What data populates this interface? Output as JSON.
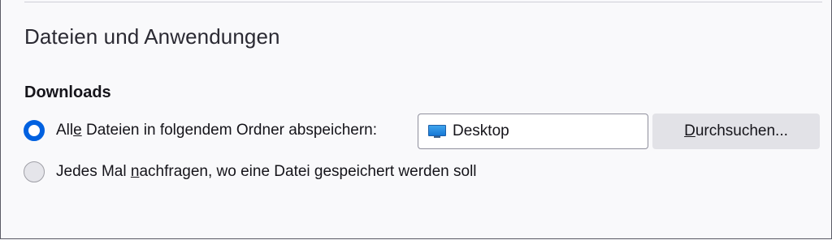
{
  "section": {
    "title": "Dateien und Anwendungen"
  },
  "downloads": {
    "heading": "Downloads",
    "option_save_to_folder": {
      "label_before": "All",
      "label_accesskey": "e",
      "label_after": " Dateien in folgendem Ordner abspeichern:",
      "checked": true
    },
    "folder": {
      "name": "Desktop",
      "icon": "desktop-icon"
    },
    "browse_button": {
      "label_accesskey": "D",
      "label_after": "urchsuchen..."
    },
    "option_always_ask": {
      "label_before": "Jedes Mal ",
      "label_accesskey": "n",
      "label_after": "achfragen, wo eine Datei gespeichert werden soll",
      "checked": false
    }
  },
  "colors": {
    "accent": "#0061e0",
    "background": "#f9f9fb",
    "button_background": "#e2e2e7"
  }
}
